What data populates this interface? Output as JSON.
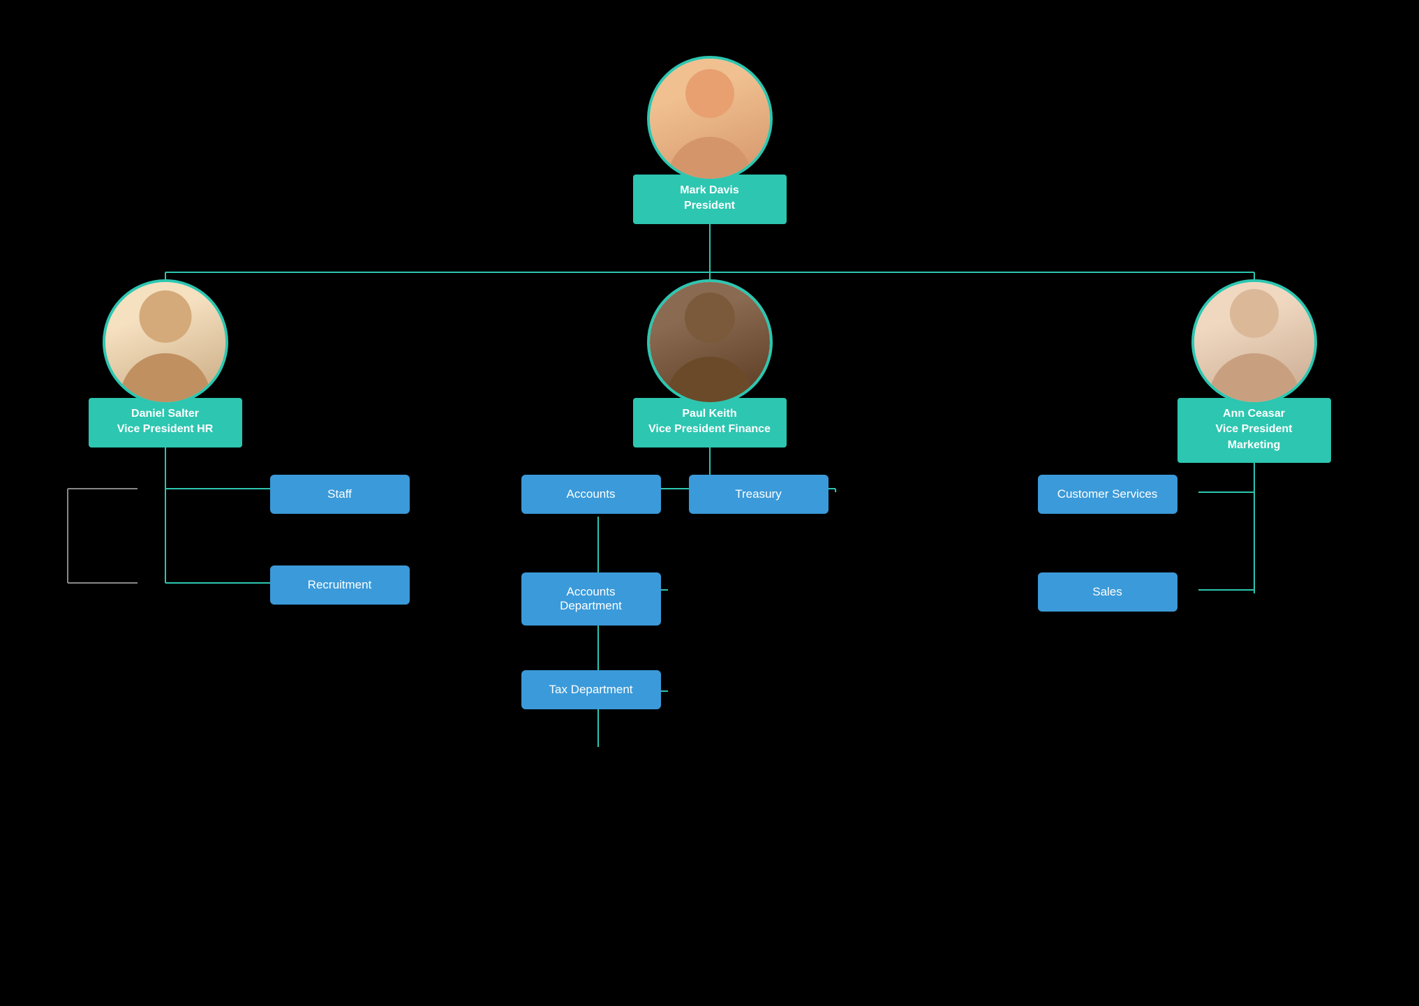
{
  "chart": {
    "background": "#000000",
    "accent_color": "#2dc6b0",
    "dept_color": "#3b9ad9",
    "top_person": {
      "name": "Mark Davis",
      "title": "President"
    },
    "vp_left": {
      "name": "Daniel Salter",
      "title": "Vice President HR"
    },
    "vp_center": {
      "name": "Paul Keith",
      "title": "Vice President Finance"
    },
    "vp_right": {
      "name": "Ann Ceasar",
      "title": "Vice President Marketing"
    },
    "left_depts": [
      "Staff",
      "Recruitment"
    ],
    "center_depts_top": [
      "Accounts",
      "Treasury"
    ],
    "center_depts_bottom": [
      "Accounts Department",
      "Tax Department"
    ],
    "right_depts": [
      "Customer Services",
      "Sales"
    ]
  }
}
